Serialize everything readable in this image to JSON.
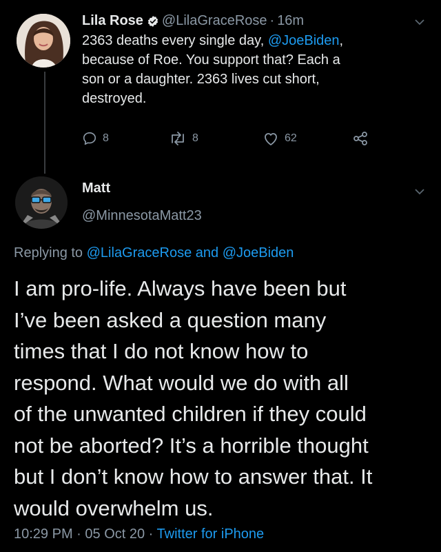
{
  "quoted_tweet": {
    "display_name": "Lila Rose",
    "handle": "@LilaGraceRose",
    "separator": "·",
    "time": "16m",
    "text_parts": {
      "a": "2363 deaths every single day, ",
      "mention": "@JoeBiden",
      "b": ",\nbecause of Roe. You support that? Each a\nson or a daughter. 2363 lives cut short,\ndestroyed."
    },
    "actions": {
      "reply_count": "8",
      "retweet_count": "8",
      "like_count": "62"
    }
  },
  "reply_tweet": {
    "display_name": "Matt",
    "handle": "@MinnesotaMatt23",
    "replying_prefix": "Replying to ",
    "replying_mention_1": "@LilaGraceRose",
    "replying_and": " and ",
    "replying_mention_2": "@JoeBiden",
    "body": "I am pro-life. Always have been but\nI’ve been asked a question many\ntimes that I do not know how to\nrespond. What would we do with all\nof the unwanted children if they could\nnot be aborted? It’s a horrible thought\nbut I don’t know how to answer that. It\nwould overwhelm us.",
    "meta_time": "10:29 PM",
    "meta_sep_1": " · ",
    "meta_date": "05 Oct 20",
    "meta_sep_2": " · ",
    "meta_source": "Twitter for iPhone"
  },
  "colors": {
    "background": "#000000",
    "text": "#e7e9ea",
    "muted": "#8b98a5",
    "accent": "#1d9bf0"
  },
  "icons": {
    "verified": "verified-badge-icon",
    "reply": "reply-icon",
    "retweet": "retweet-icon",
    "like": "heart-icon",
    "share": "share-icon",
    "more": "chevron-down-icon"
  }
}
